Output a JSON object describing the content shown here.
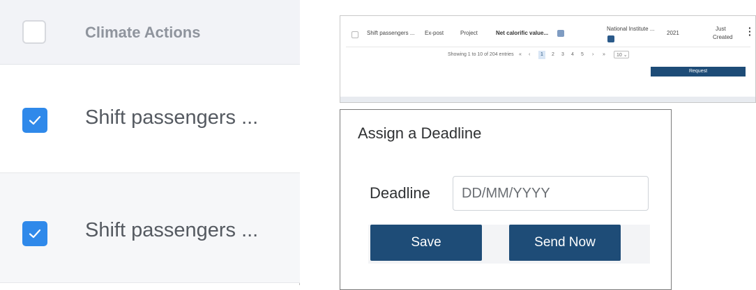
{
  "left_table": {
    "header": "Climate Actions",
    "rows": [
      {
        "label": "Shift passengers ...",
        "checked": true
      },
      {
        "label": "Shift passengers ...",
        "checked": true
      }
    ]
  },
  "table_snippet": {
    "row": {
      "name": "Shift passengers ...",
      "type": "Ex-post",
      "level": "Project",
      "parameter": "Net calorific value...",
      "institution": "National Institute ...",
      "year": "2021",
      "status_line1": "Just",
      "status_line2": "Created"
    },
    "pagination": {
      "summary": "Showing 1 to 10 of 204 entries",
      "first": "«",
      "prev": "‹",
      "pages": [
        "1",
        "2",
        "3",
        "4",
        "5"
      ],
      "next": "›",
      "last": "»",
      "page_size": "10",
      "page_size_caret": "⌄"
    },
    "request_button": "Request"
  },
  "dialog": {
    "title": "Assign a Deadline",
    "deadline_label": "Deadline",
    "deadline_placeholder": "DD/MM/YYYY",
    "save_label": "Save",
    "send_label": "Send Now"
  },
  "colors": {
    "checkbox_blue": "#2f89ea",
    "button_navy": "#1e4c77"
  }
}
